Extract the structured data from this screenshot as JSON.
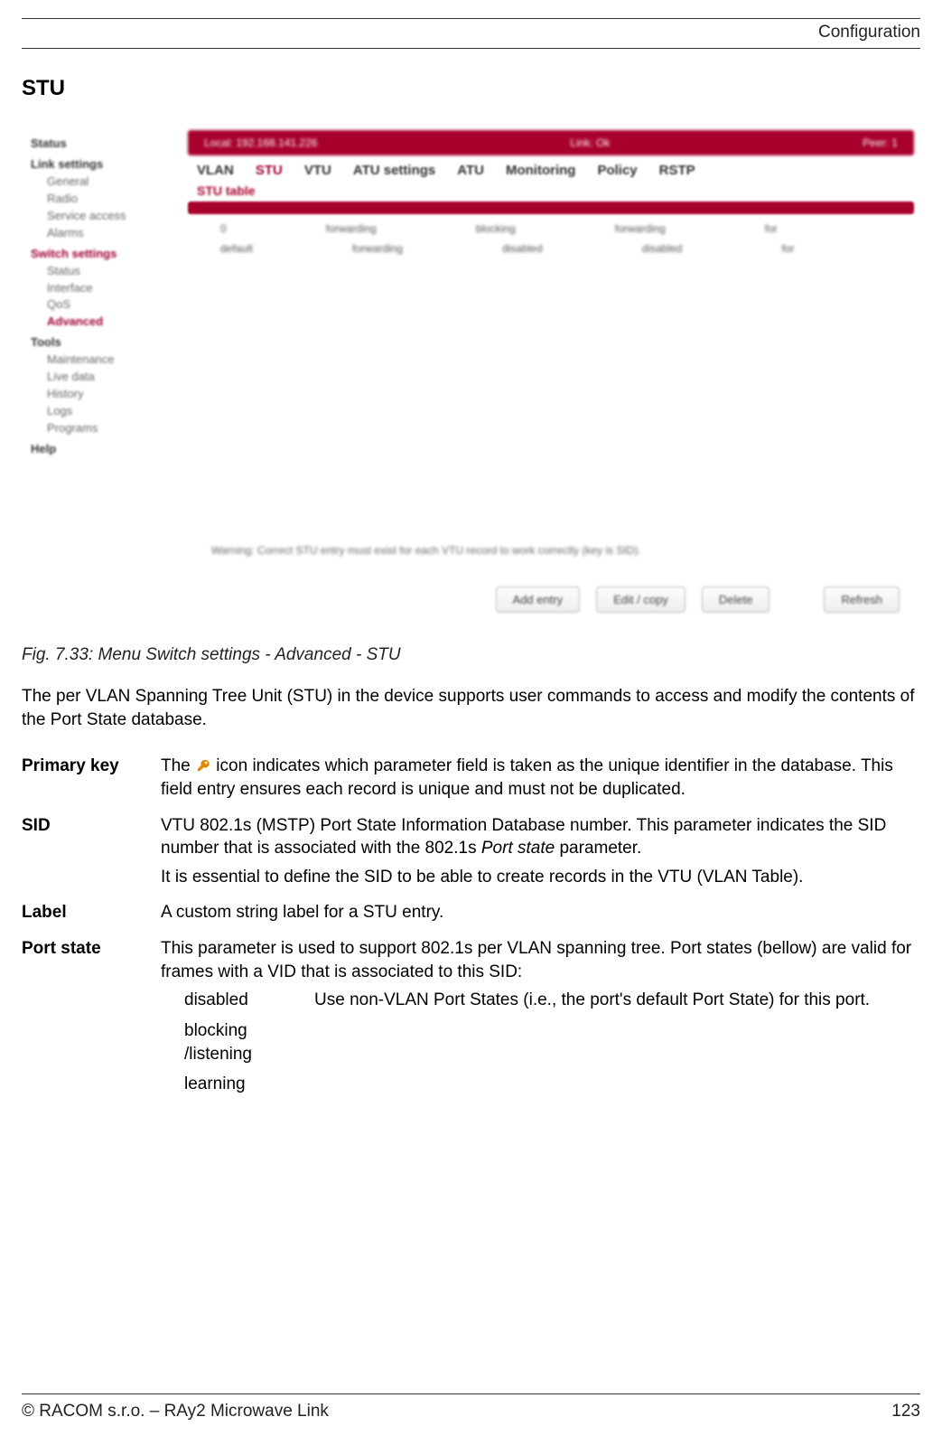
{
  "header": {
    "right": "Configuration"
  },
  "section_title": "STU",
  "screenshot": {
    "sidebar": {
      "groups": [
        {
          "label": "Status",
          "items": []
        },
        {
          "label": "Link settings",
          "items": [
            {
              "label": "General"
            },
            {
              "label": "Radio"
            },
            {
              "label": "Service access"
            },
            {
              "label": "Alarms"
            }
          ]
        },
        {
          "label": "Switch settings",
          "active_group": true,
          "items": [
            {
              "label": "Status"
            },
            {
              "label": "Interface"
            },
            {
              "label": "QoS"
            },
            {
              "label": "Advanced",
              "active": true
            }
          ]
        },
        {
          "label": "Tools",
          "items": [
            {
              "label": "Maintenance"
            },
            {
              "label": "Live data"
            },
            {
              "label": "History"
            },
            {
              "label": "Logs"
            },
            {
              "label": "Programs"
            }
          ]
        },
        {
          "label": "Help",
          "items": []
        }
      ]
    },
    "topbar": {
      "left": "Local: 192.168.141.226",
      "mid": "Link: Ok",
      "right": "Peer: 1"
    },
    "tabs": [
      "VLAN",
      "STU",
      "VTU",
      "ATU settings",
      "ATU",
      "Monitoring",
      "Policy",
      "RSTP"
    ],
    "subhead": "STU table",
    "rows": [
      [
        "0",
        "",
        "forwarding",
        "blocking",
        "forwarding",
        "for"
      ],
      [
        "default",
        "",
        "forwarding",
        "disabled",
        "disabled",
        "for"
      ]
    ],
    "footer_note": "Warning: Correct STU entry must exist for each VTU record to work correctly (key is SID).",
    "buttons": [
      "Add entry",
      "Edit / copy",
      "Delete",
      "Refresh"
    ]
  },
  "caption": "Fig. 7.33: Menu Switch settings - Advanced - STU",
  "intro": "The per VLAN Spanning Tree Unit (STU) in the device supports user commands to access and modify the contents of the Port State database.",
  "definitions": [
    {
      "term": "Primary key",
      "desc_parts": {
        "before": "The ",
        "after": " icon indicates which parameter field is taken as the unique identifier in the database. This field entry ensures each record is unique and must not be duplicated."
      }
    },
    {
      "term": "SID",
      "desc_lines": [
        {
          "pre": "VTU 802.1s (MSTP) Port State Information Database number. This parameter indicates the SID number that is associated with the 802.1s ",
          "it": "Port state",
          "post": " parameter."
        },
        {
          "text": "It is essential to define the SID to be able to create records in the VTU (VLAN Table)."
        }
      ]
    },
    {
      "term": "Label",
      "desc": "A custom string label for a STU entry."
    },
    {
      "term": "Port state",
      "desc": "This parameter is used to support 802.1s per VLAN spanning tree. Port states (bellow) are valid for frames with a VID that is associated to this SID:",
      "sub": [
        {
          "k": "disabled",
          "v": "Use non-VLAN Port States (i.e., the port's default Port State) for this port."
        },
        {
          "k": "blocking /listening",
          "v": ""
        },
        {
          "k": "learning",
          "v": ""
        }
      ]
    }
  ],
  "footer": {
    "left": "© RACOM s.r.o. – RAy2 Microwave Link",
    "right": "123"
  }
}
